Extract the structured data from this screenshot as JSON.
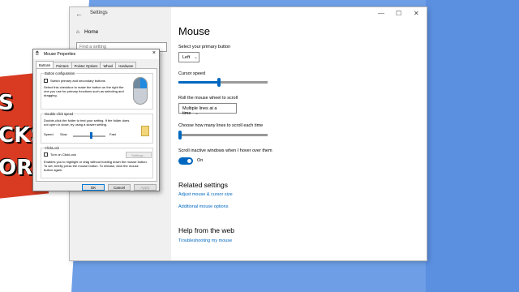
{
  "background": {
    "lines": [
      "S",
      "CKS",
      "ORI"
    ]
  },
  "settings": {
    "window_title": "Settings",
    "home_label": "Home",
    "search_placeholder": "Find a setting",
    "page_title": "Mouse",
    "primary_button": {
      "label": "Select your primary button",
      "value": "Left"
    },
    "cursor_speed": {
      "label": "Cursor speed",
      "level_fraction": 0.45
    },
    "wheel": {
      "label": "Roll the mouse wheel to scroll",
      "value": "Multiple lines at a time"
    },
    "lines": {
      "label": "Choose how many lines to scroll each time",
      "level_fraction": 0.02
    },
    "inactive_scroll": {
      "label": "Scroll inactive windows when I hover over them",
      "state": "On"
    },
    "related": {
      "heading": "Related settings",
      "links": [
        "Adjust mouse & cursor size",
        "Additional mouse options"
      ]
    },
    "help": {
      "heading": "Help from the web",
      "links": [
        "Troubleshooting my mouse"
      ]
    }
  },
  "dialog": {
    "title": "Mouse Properties",
    "tabs": [
      "Buttons",
      "Pointers",
      "Pointer Options",
      "Wheel",
      "Hardware"
    ],
    "button_config": {
      "caption": "Button configuration",
      "checkbox_label": "Switch primary and secondary buttons",
      "description": "Select this checkbox to make the button on the right the one you use for primary functions such as selecting and dragging."
    },
    "double_click": {
      "caption": "Double-click speed",
      "description": "Double-click the folder to test your setting. If the folder does not open or close, try using a slower setting.",
      "speed_label": "Speed",
      "slow": "Slow",
      "fast": "Fast",
      "level_fraction": 0.55
    },
    "clicklock": {
      "caption": "ClickLock",
      "checkbox_label": "Turn on ClickLock",
      "settings_button": "Settings...",
      "description": "Enables you to highlight or drag without holding down the mouse button. To set, briefly press the mouse button. To release, click the mouse button again."
    },
    "buttons": {
      "ok": "OK",
      "cancel": "Cancel",
      "apply": "Apply"
    }
  }
}
